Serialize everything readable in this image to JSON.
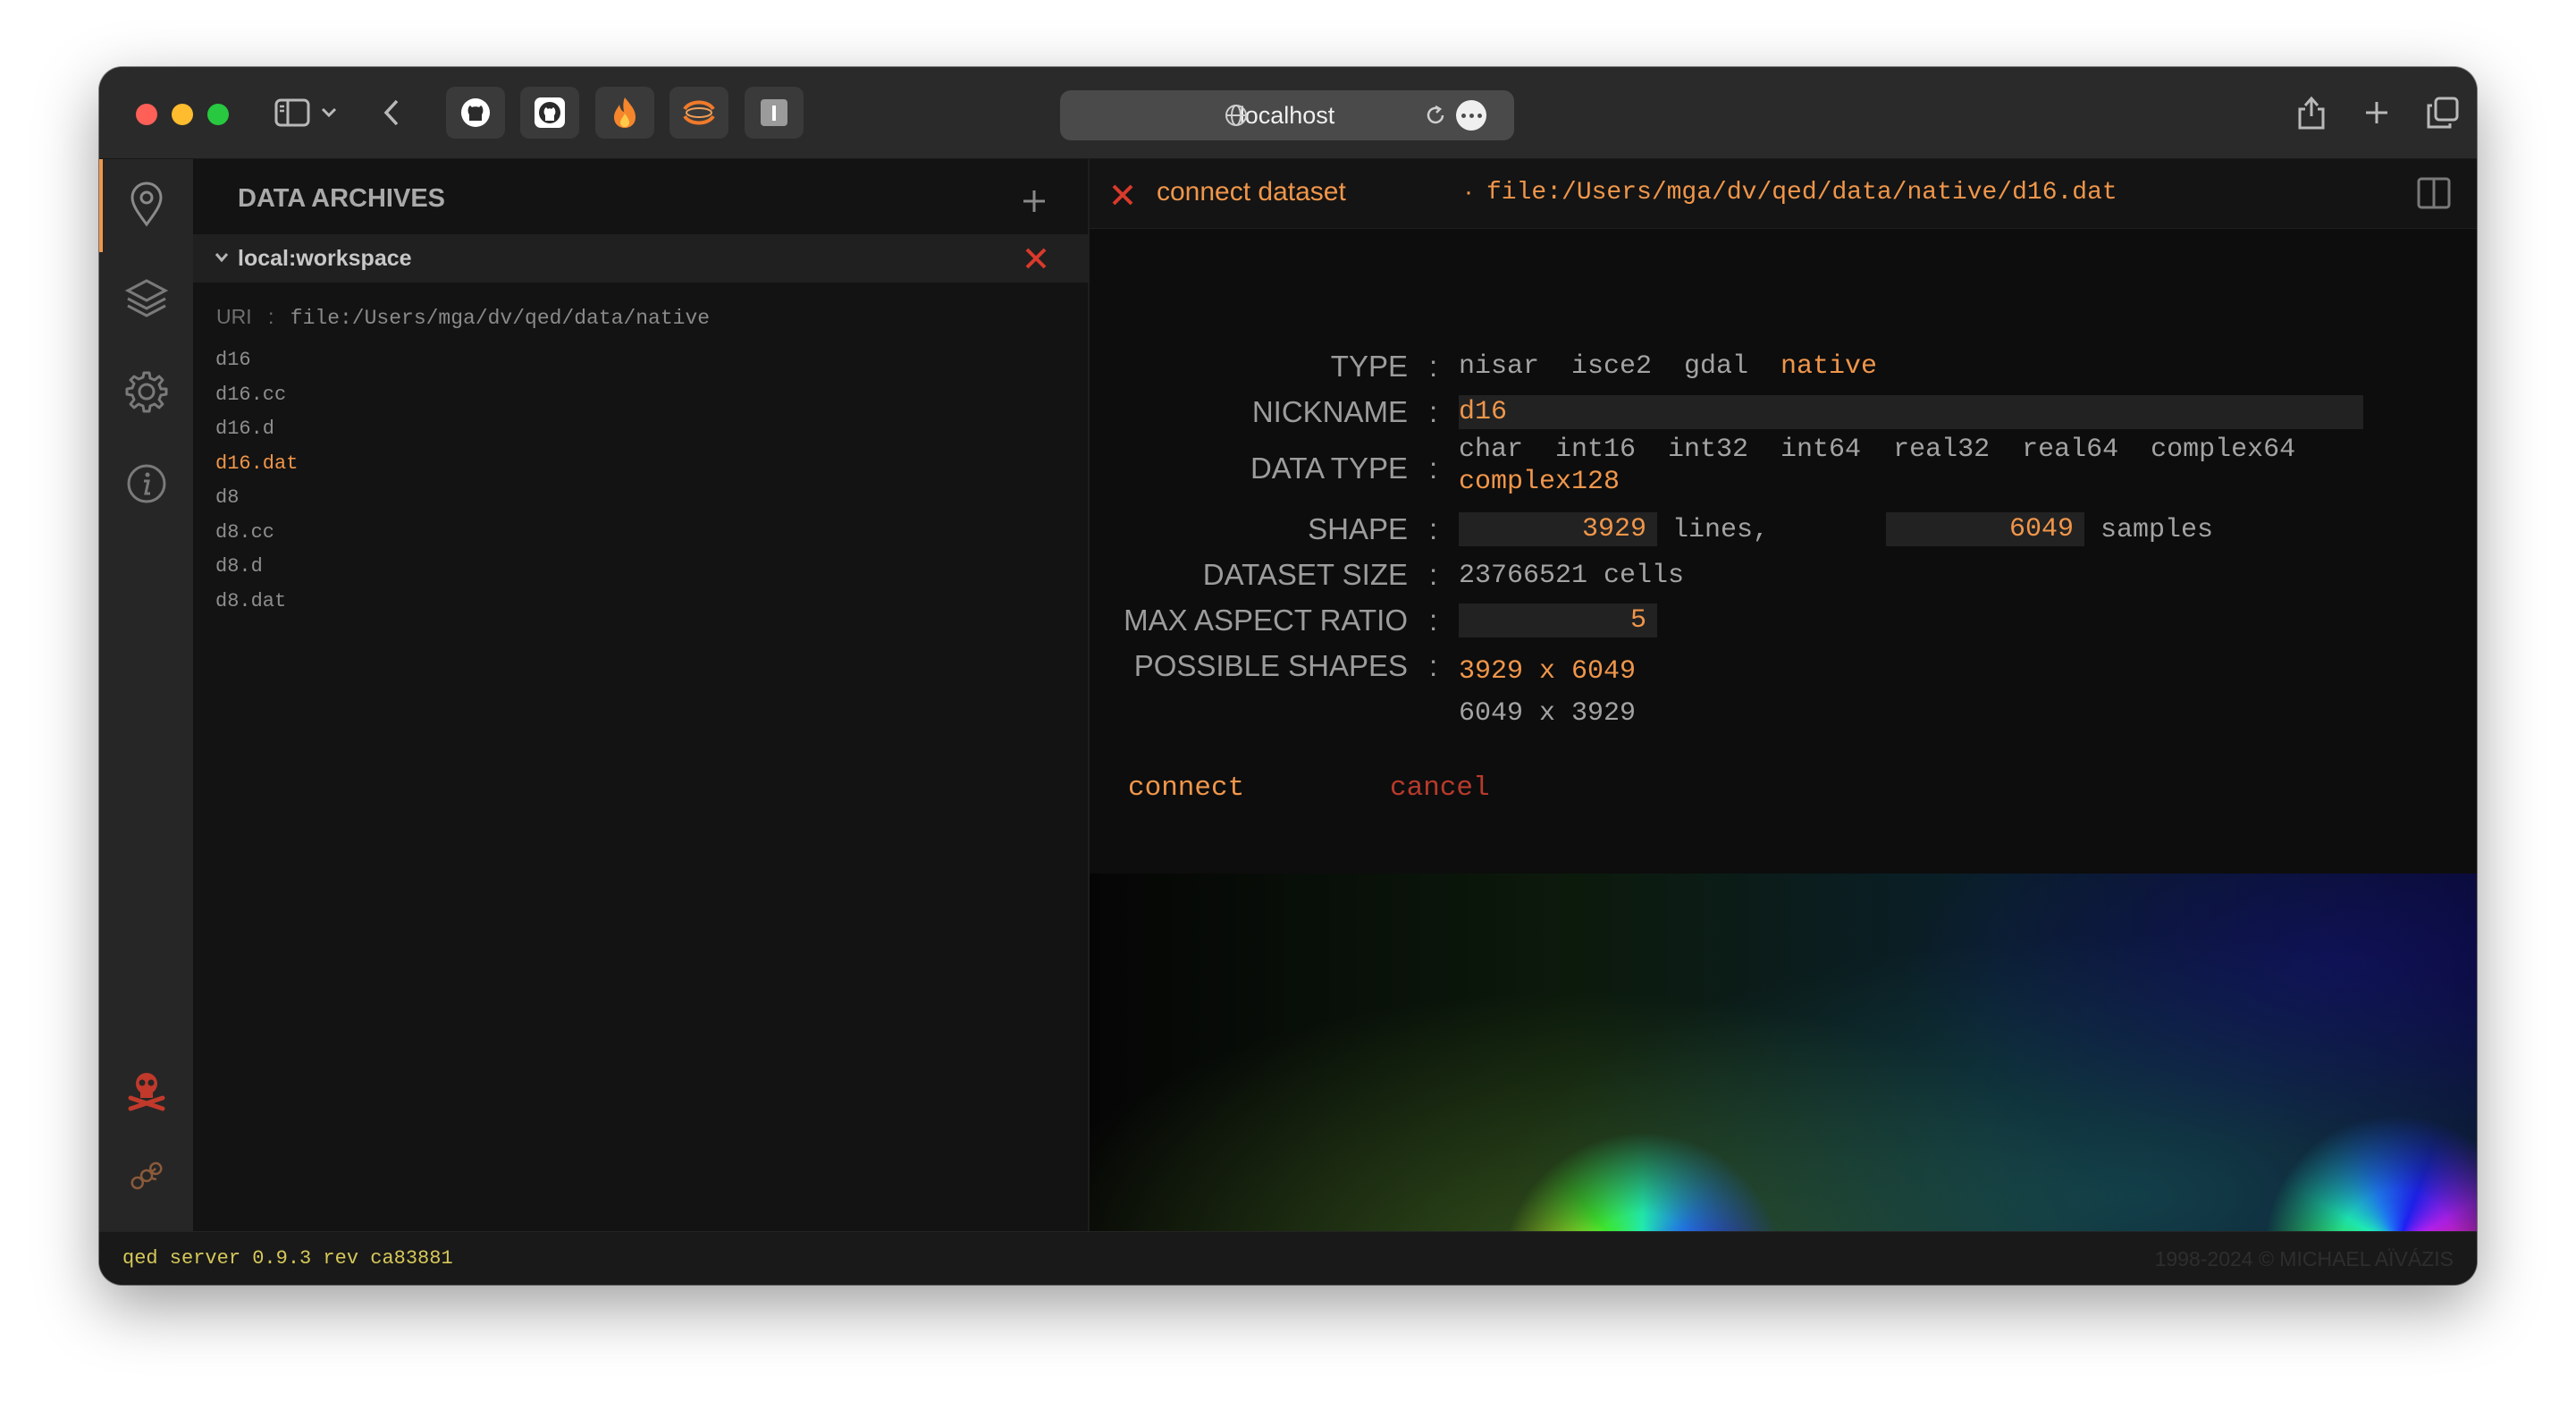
{
  "browser": {
    "url": "localhost",
    "extensions": [
      "github-icon",
      "github-outline-icon",
      "flame-icon",
      "swirl-icon",
      "info-box-icon"
    ]
  },
  "sidebar": {
    "title": "DATA ARCHIVES",
    "archive": {
      "name": "local:workspace",
      "uri_label": "URI",
      "uri": "file:/Users/mga/dv/qed/data/native",
      "files": [
        "d16",
        "d16.cc",
        "d16.d",
        "d16.dat",
        "d8",
        "d8.cc",
        "d8.d",
        "d8.dat"
      ],
      "selected_file": "d16.dat"
    }
  },
  "connect": {
    "title": "connect dataset",
    "separator": "·",
    "path": "file:/Users/mga/dv/qed/data/native/d16.dat",
    "fields": {
      "type_label": "TYPE",
      "type_options": [
        "nisar",
        "isce2",
        "gdal",
        "native"
      ],
      "type_selected": "native",
      "nickname_label": "NICKNAME",
      "nickname_value": "d16",
      "datatype_label": "DATA TYPE",
      "datatype_options": [
        "char",
        "int16",
        "int32",
        "int64",
        "real32",
        "real64",
        "complex64",
        "complex128"
      ],
      "datatype_selected": "complex128",
      "shape_label": "SHAPE",
      "shape_lines": "3929",
      "shape_lines_unit": "lines,",
      "shape_samples": "6049",
      "shape_samples_unit": "samples",
      "size_label": "DATASET SIZE",
      "size_value": "23766521 cells",
      "aspect_label": "MAX ASPECT RATIO",
      "aspect_value": "5",
      "shapes_label": "POSSIBLE SHAPES",
      "possible_shapes": [
        "3929 x 6049",
        "6049 x 3929"
      ],
      "shape_selected": "3929 x 6049",
      "colon": ":"
    },
    "connect_label": "connect",
    "cancel_label": "cancel"
  },
  "status": {
    "server": "qed server 0.9.3 rev ca83881",
    "copyright": "1998-2024 © MICHAEL AÏVÁZIS"
  },
  "colors": {
    "accent": "#f0964a",
    "danger": "#d93a2b",
    "status_text": "#d6c85a"
  }
}
